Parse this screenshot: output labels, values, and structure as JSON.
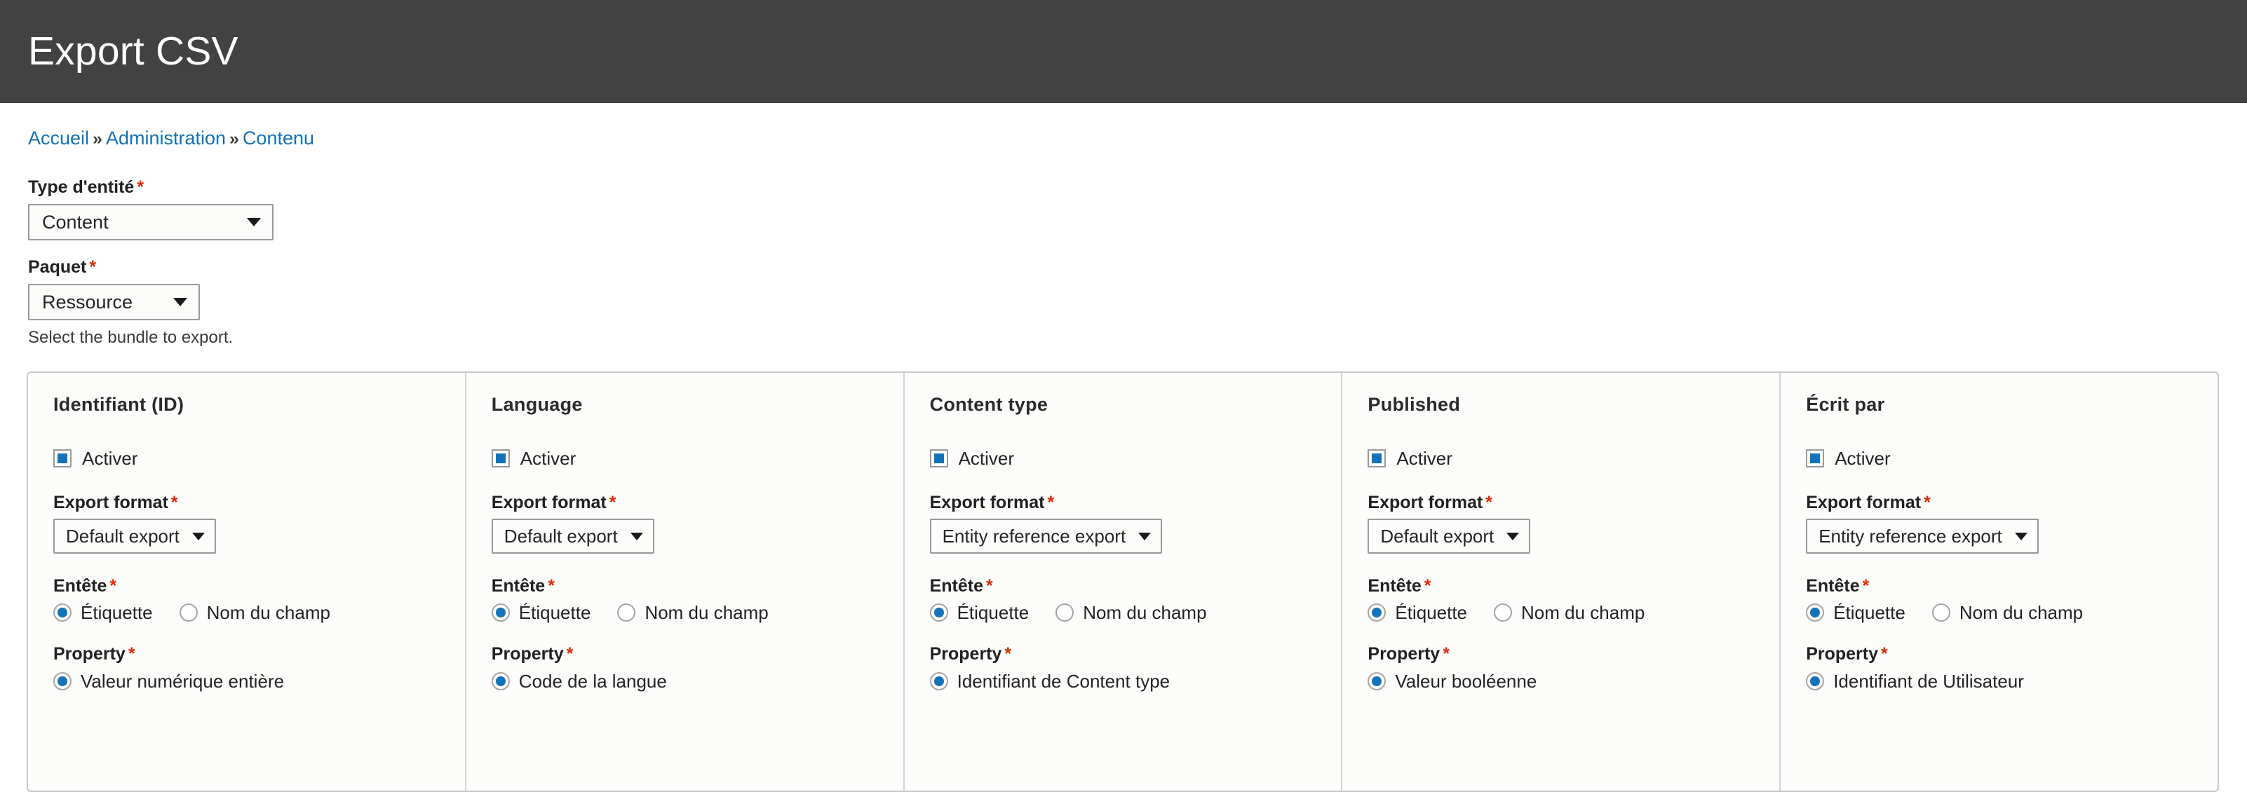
{
  "header": {
    "title": "Export CSV"
  },
  "breadcrumb": {
    "separator": "»",
    "items": [
      {
        "label": "Accueil"
      },
      {
        "label": "Administration"
      },
      {
        "label": "Contenu"
      }
    ]
  },
  "top_form": {
    "entity_type": {
      "label": "Type d'entité",
      "required_marker": "*",
      "value": "Content"
    },
    "bundle": {
      "label": "Paquet",
      "required_marker": "*",
      "value": "Ressource",
      "description": "Select the bundle to export."
    }
  },
  "common": {
    "required_marker": "*",
    "enable_label": "Activer",
    "export_format_label": "Export format",
    "header_label": "Entête",
    "property_label": "Property",
    "header_options": [
      {
        "label": "Étiquette"
      },
      {
        "label": "Nom du champ"
      }
    ]
  },
  "colors": {
    "header_bar": "#424242",
    "link": "#1071b9",
    "required": "#e32700",
    "accent": "#1273ba",
    "panel_bg": "#fcfcfa",
    "panel_border": "#c9c9c9"
  },
  "columns": [
    {
      "title": "Identifiant (ID)",
      "enabled": true,
      "export_format": "Default export",
      "header_selected_index": 0,
      "property": "Valeur numérique entière",
      "property_selected": true
    },
    {
      "title": "Language",
      "enabled": true,
      "export_format": "Default export",
      "header_selected_index": 0,
      "property": "Code de la langue",
      "property_selected": true
    },
    {
      "title": "Content type",
      "enabled": true,
      "export_format": "Entity reference export",
      "header_selected_index": 0,
      "property": "Identifiant de Content type",
      "property_selected": true
    },
    {
      "title": "Published",
      "enabled": true,
      "export_format": "Default export",
      "header_selected_index": 0,
      "property": "Valeur booléenne",
      "property_selected": true
    },
    {
      "title": "Écrit par",
      "enabled": true,
      "export_format": "Entity reference export",
      "header_selected_index": 0,
      "property": "Identifiant de Utilisateur",
      "property_selected": true
    }
  ]
}
